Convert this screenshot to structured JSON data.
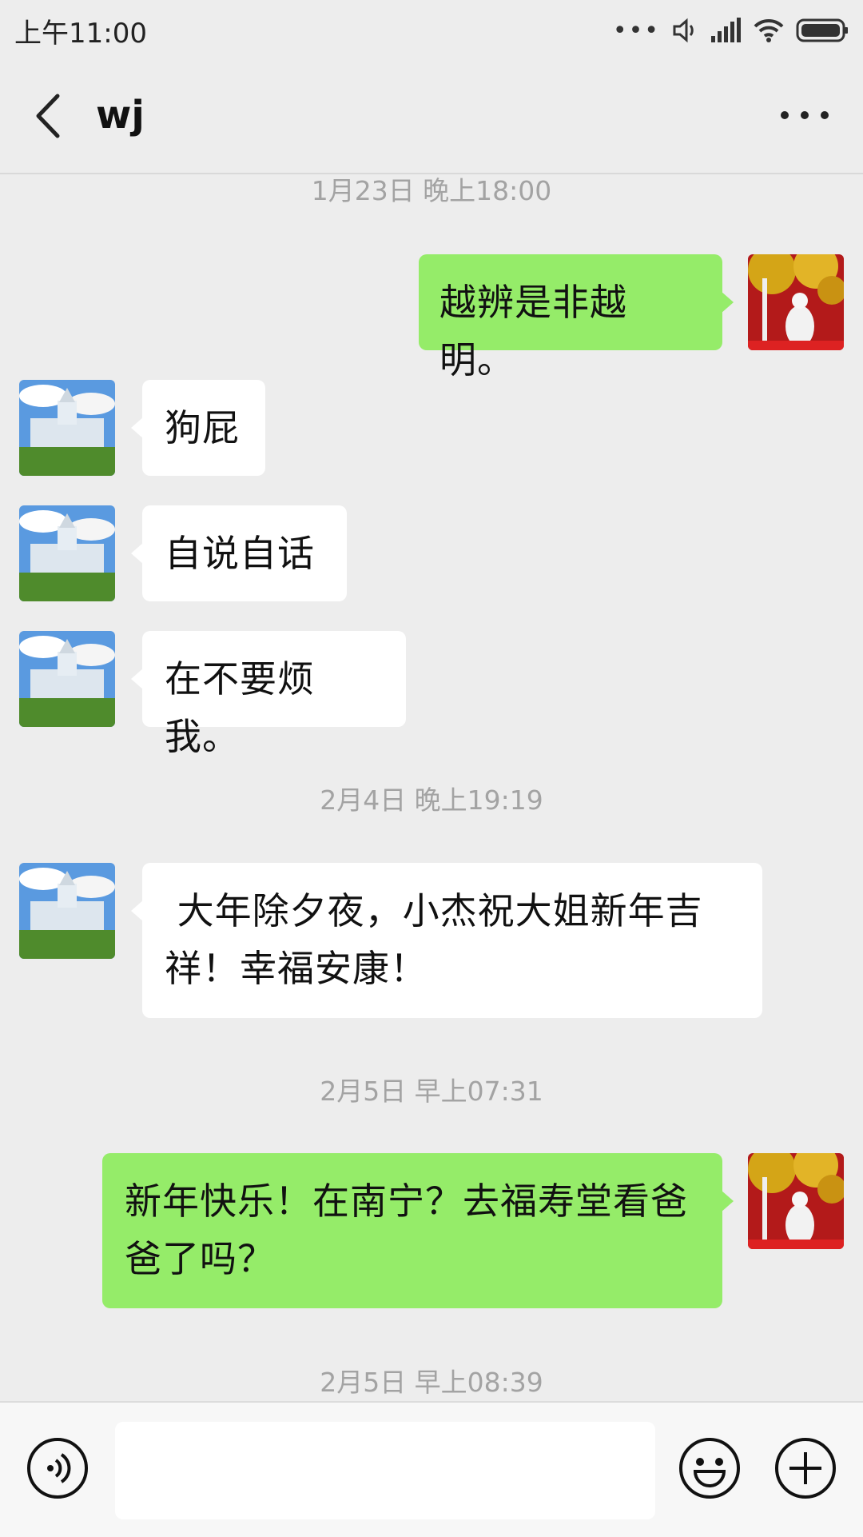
{
  "status_bar": {
    "time": "上午11:00"
  },
  "header": {
    "title": "wj"
  },
  "messages": [
    {
      "type": "timestamp",
      "text": "1月23日 晚上18:00"
    },
    {
      "type": "out",
      "text": "越辨是非越明。"
    },
    {
      "type": "in",
      "text": "狗屁"
    },
    {
      "type": "in",
      "text": "自说自话"
    },
    {
      "type": "in",
      "text": "在不要烦我。"
    },
    {
      "type": "timestamp",
      "text": "2月4日 晚上19:19"
    },
    {
      "type": "in",
      "text": " 大年除夕夜，小杰祝大姐新年吉祥！幸福安康！"
    },
    {
      "type": "timestamp",
      "text": "2月5日 早上07:31"
    },
    {
      "type": "out",
      "text": "新年快乐！在南宁？去福寿堂看爸爸了吗？"
    },
    {
      "type": "timestamp",
      "text": "2月5日 早上08:39"
    }
  ],
  "input": {
    "value": ""
  },
  "icons": {
    "back": "back-arrow-icon",
    "more": "more-icon",
    "voice": "voice-icon",
    "emoji": "emoji-icon",
    "plus": "plus-icon"
  },
  "colors": {
    "outgoing_bubble": "#95ec69",
    "incoming_bubble": "#ffffff",
    "background": "#ededed"
  }
}
